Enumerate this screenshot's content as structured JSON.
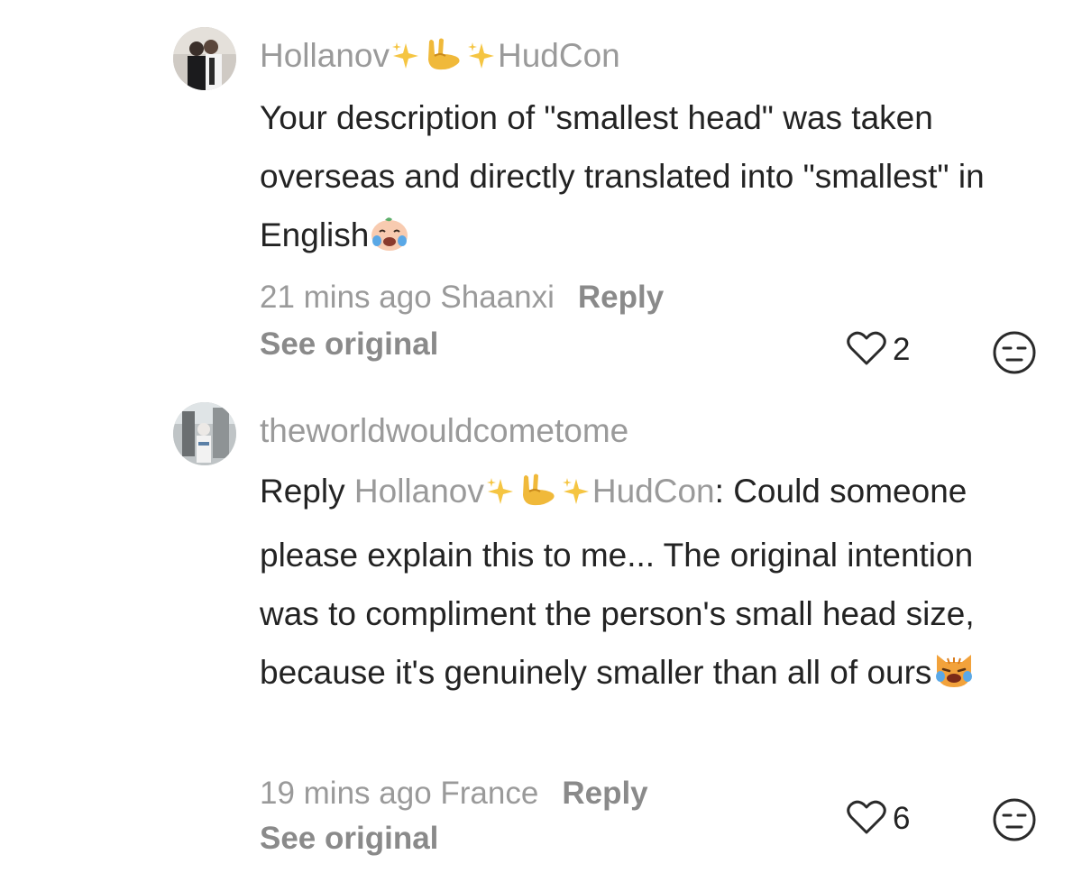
{
  "comments": [
    {
      "username_prefix": "Hollanov",
      "username_suffix": "HudCon",
      "username_emojis": [
        "sparkles-emoji",
        "sign-of-horns-emoji",
        "sparkles-emoji"
      ],
      "text": "Your description of \"smallest head\" was taken overseas and directly translated into \"smallest\" in English",
      "trailing_emoji": "crying-baby-face-emoji",
      "time_location": "21 mins ago Shaanxi",
      "reply_label": "Reply",
      "see_original_label": "See original",
      "like_count": "2",
      "like_icon": "heart-outline-icon",
      "react_icon": "unamused-face-icon"
    },
    {
      "username": "theworldwouldcometome",
      "reply_prefix": "Reply",
      "reply_target_prefix": "Hollanov",
      "reply_target_suffix": "HudCon",
      "reply_colon": ":",
      "text": " Could someone please explain this to me... The original intention was to compliment the person's small head size, because it's genuinely smaller than all of ours",
      "trailing_emoji": "crying-cat-face-emoji",
      "time_location": "19 mins ago France",
      "reply_label": "Reply",
      "see_original_label": "See original",
      "like_count": "6",
      "like_icon": "heart-outline-icon",
      "react_icon": "unamused-face-icon"
    }
  ],
  "colors": {
    "primary_text": "#232323",
    "secondary_text": "#9a9a9a",
    "action_text": "#8a8a8a",
    "emoji_yellow": "#f5c542"
  }
}
